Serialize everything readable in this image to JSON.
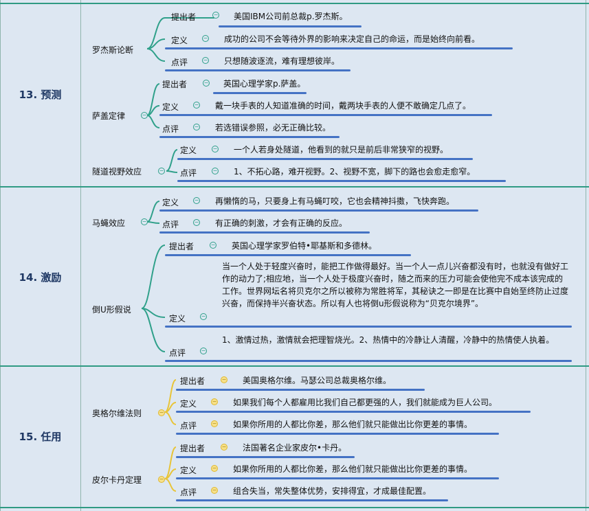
{
  "sections": [
    {
      "title": "13. 预测",
      "topics": [
        {
          "name": "罗杰斯论断",
          "rows": [
            {
              "label": "提出者",
              "text": "美国IBM公司前总裁p.罗杰斯。"
            },
            {
              "label": "定义",
              "text": "成功的公司不会等待外界的影响来决定自己的命运，而是始终向前看。"
            },
            {
              "label": "点评",
              "text": "只想随波逐流，难有理想彼岸。"
            }
          ]
        },
        {
          "name": "萨盖定律",
          "rows": [
            {
              "label": "提出者",
              "text": "英国心理学家p.萨盖。"
            },
            {
              "label": "定义",
              "text": "戴一块手表的人知道准确的时间，戴两块手表的人便不敢确定几点了。"
            },
            {
              "label": "点评",
              "text": "若选错误参照，必无正确比较。"
            }
          ]
        },
        {
          "name": "隧道视野效应",
          "rows": [
            {
              "label": "定义",
              "text": "一个人若身处隧道，他看到的就只是前后非常狭窄的视野。"
            },
            {
              "label": "点评",
              "text": "1、不拓心路，难开视野。2、视野不宽，脚下的路也会愈走愈窄。"
            }
          ]
        }
      ]
    },
    {
      "title": "14. 激励",
      "topics": [
        {
          "name": "马蝇效应",
          "rows": [
            {
              "label": "定义",
              "text": "再懒惰的马，只要身上有马蝇叮咬，它也会精神抖擞，飞快奔跑。"
            },
            {
              "label": "点评",
              "text": "有正确的刺激，才会有正确的反应。"
            }
          ]
        },
        {
          "name": "倒U形假说",
          "rows": [
            {
              "label": "提出者",
              "text": "英国心理学家罗伯特•耶基斯和多德林。"
            },
            {
              "label": "定义",
              "text": "当一个人处于轻度兴奋时，能把工作做得最好。当一个人一点儿兴奋都没有时，也就没有做好工作的动力了;相应地，当一个人处于极度兴奋时，随之而来的压力可能会使他完不成本该完成的工作。世界网坛名将贝克尔之所以被称为常胜将军，其秘诀之一即是在比赛中自始至终防止过度兴奋，而保持半兴奋状态。所以有人也将倒u形假说称为“贝克尔境界”。"
            },
            {
              "label": "点评",
              "text": "1、激情过热，激情就会把理智烧光。2、热情中的冷静让人清醒，冷静中的热情使人执着。"
            }
          ]
        }
      ]
    },
    {
      "title": "15. 任用",
      "topics": [
        {
          "name": "奥格尔维法则",
          "rows": [
            {
              "label": "提出者",
              "text": "美国奥格尔维。马瑟公司总裁奥格尔维。"
            },
            {
              "label": "定义",
              "text": "如果我们每个人都雇用比我们自己都更强的人，我们就能成为巨人公司。"
            },
            {
              "label": "点评",
              "text": "如果你所用的人都比你差，那么他们就只能做出比你更差的事情。"
            }
          ]
        },
        {
          "name": "皮尔卡丹定理",
          "rows": [
            {
              "label": "提出者",
              "text": "法国著名企业家皮尔•卡丹。"
            },
            {
              "label": "定义",
              "text": "如果你所用的人都比你差，那么他们就只能做出比你更差的事情。"
            },
            {
              "label": "点评",
              "text": "组合失当，常失整体优势，安排得宜，才成最佳配置。"
            }
          ]
        }
      ]
    }
  ],
  "colors": {
    "section_title": "#1f3864",
    "branch_teal": "#2fa08a",
    "branch_gold": "#e0b82e",
    "underline_blue": "#4472c4",
    "background": "#dde7f2",
    "divider": "#2f9a83"
  },
  "icons": {
    "collapse_toggle": "minus-circle-icon"
  }
}
